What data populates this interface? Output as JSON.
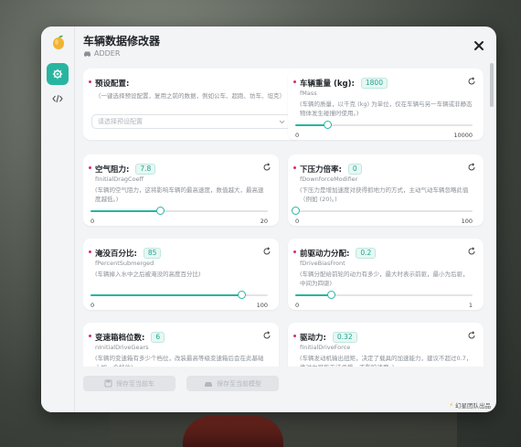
{
  "app": {
    "title": "车辆数据修改器",
    "vehicle": "ADDER",
    "brand": "幻星团队出品"
  },
  "colors": {
    "accent": "#27b5a1",
    "required": "#d62b70"
  },
  "preset": {
    "label": "预设配置:",
    "desc": "（一键选择预设配置，复用之前的数据，例如公车、超跑、坊车、坦克）",
    "placeholder": "请选择预设配置"
  },
  "params": {
    "mass": {
      "label": "车辆重量 (kg):",
      "value": "1800",
      "key": "fMass",
      "desc": "(车辆的质量，以千克 (kg) 为单位，仅在车辆与另一车辆或非静态物体发生碰撞时使用。)",
      "min": "0",
      "max": "10000",
      "ratio": 0.18
    },
    "drag": {
      "label": "空气阻力:",
      "value": "7.8",
      "key": "fInitialDragCoeff",
      "desc": "(车辆的空气阻力，这将影响车辆的最高速度，数值越大，最高速度越低。)",
      "min": "0",
      "max": "20",
      "ratio": 0.39
    },
    "downforce": {
      "label": "下压力倍率:",
      "value": "0",
      "key": "fDownforceModifier",
      "desc": "(下压力是增加速度对获得抓地力的方式，主动气动车辆忽略此值（例如 (20)。)",
      "min": "0",
      "max": "100",
      "ratio": 0.0
    },
    "submerged": {
      "label": "淹没百分比:",
      "value": "85",
      "key": "fPercentSubmerged",
      "desc": "(车辆掉入水中之后被淹没的高度百分比)",
      "min": "0",
      "max": "100",
      "ratio": 0.85
    },
    "drivebias": {
      "label": "前驱动力分配:",
      "value": "0.2",
      "key": "fDriveBiasFront",
      "desc": "(车辆分配给前轮的动力有多少，最大时表示前驱，最小为后驱，中间为四驱)",
      "min": "0",
      "max": "1",
      "ratio": 0.2
    },
    "gears": {
      "label": "变速箱档位数:",
      "value": "6",
      "key": "nInitialDriveGears",
      "desc": "(车辆的变速箱有多少个档位，改装最高等级变速箱后会在此基础上加一个档位)"
    },
    "driveforce": {
      "label": "驱动力:",
      "value": "0.32",
      "key": "fInitialDriveForce",
      "desc": "(车辆发动机输出扭矩，决定了载具的加速能力，建议不超过0.7，绝对力可能无法承受，不影响速度。)"
    }
  },
  "footer": {
    "save_current": "保存至当前车",
    "save_model": "保存至当前模型"
  }
}
